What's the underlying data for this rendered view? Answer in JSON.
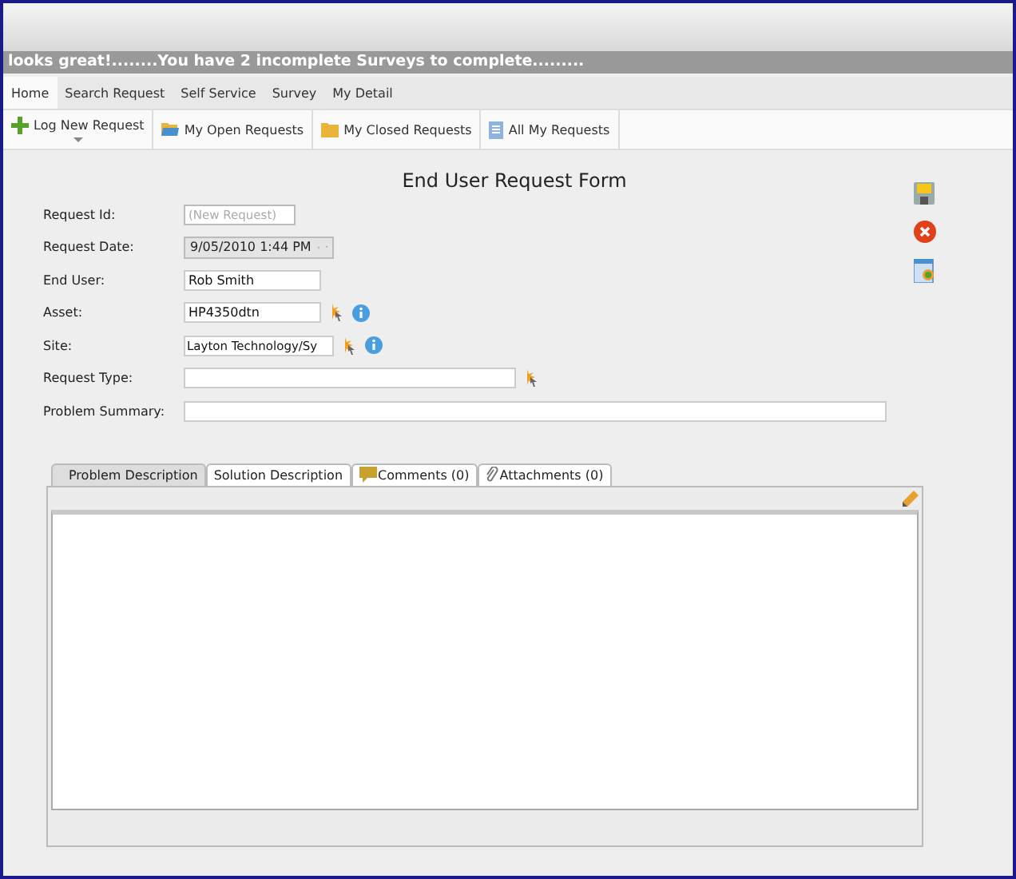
{
  "banner": "looks great!........You have 2 incomplete Surveys to complete.........",
  "nav_tabs": [
    {
      "label": "Home",
      "selected": true
    },
    {
      "label": "Search Request",
      "selected": false
    },
    {
      "label": "Self Service",
      "selected": false
    },
    {
      "label": "Survey",
      "selected": false
    },
    {
      "label": "My Detail",
      "selected": false
    }
  ],
  "toolbar": [
    {
      "label": "Log New Request",
      "kind": "plus",
      "dropdown": true
    },
    {
      "label": "My Open Requests",
      "kind": "openfolder",
      "dropdown": false
    },
    {
      "label": "My Closed Requests",
      "kind": "folder",
      "dropdown": false
    },
    {
      "label": "All My Requests",
      "kind": "list",
      "dropdown": false
    }
  ],
  "form": {
    "title": "End User Request Form",
    "fields": [
      {
        "label": "Request Id:",
        "kind": "readonly",
        "placeholder": "(New Request)"
      },
      {
        "label": "Request Date:",
        "kind": "datetime",
        "value": "9/05/2010 1:44 PM"
      },
      {
        "label": "End User:",
        "kind": "text",
        "value": "Rob Smith"
      },
      {
        "label": "Asset:",
        "kind": "lookup-info",
        "value": "HP4350dtn"
      },
      {
        "label": "Site:",
        "kind": "lookup-info",
        "value": "Layton Technology/Sy"
      },
      {
        "label": "Request Type:",
        "kind": "lookup-wide"
      },
      {
        "label": "Problem Summary:",
        "kind": "full"
      }
    ]
  },
  "detail_tabs": [
    {
      "label": "Problem Description",
      "kind": "plain",
      "selected": true
    },
    {
      "label": "Solution Description",
      "kind": "plain",
      "selected": false
    },
    {
      "label": "Comments (0)",
      "kind": "comment",
      "selected": false
    },
    {
      "label": "Attachments (0)",
      "kind": "attach",
      "selected": false
    }
  ]
}
